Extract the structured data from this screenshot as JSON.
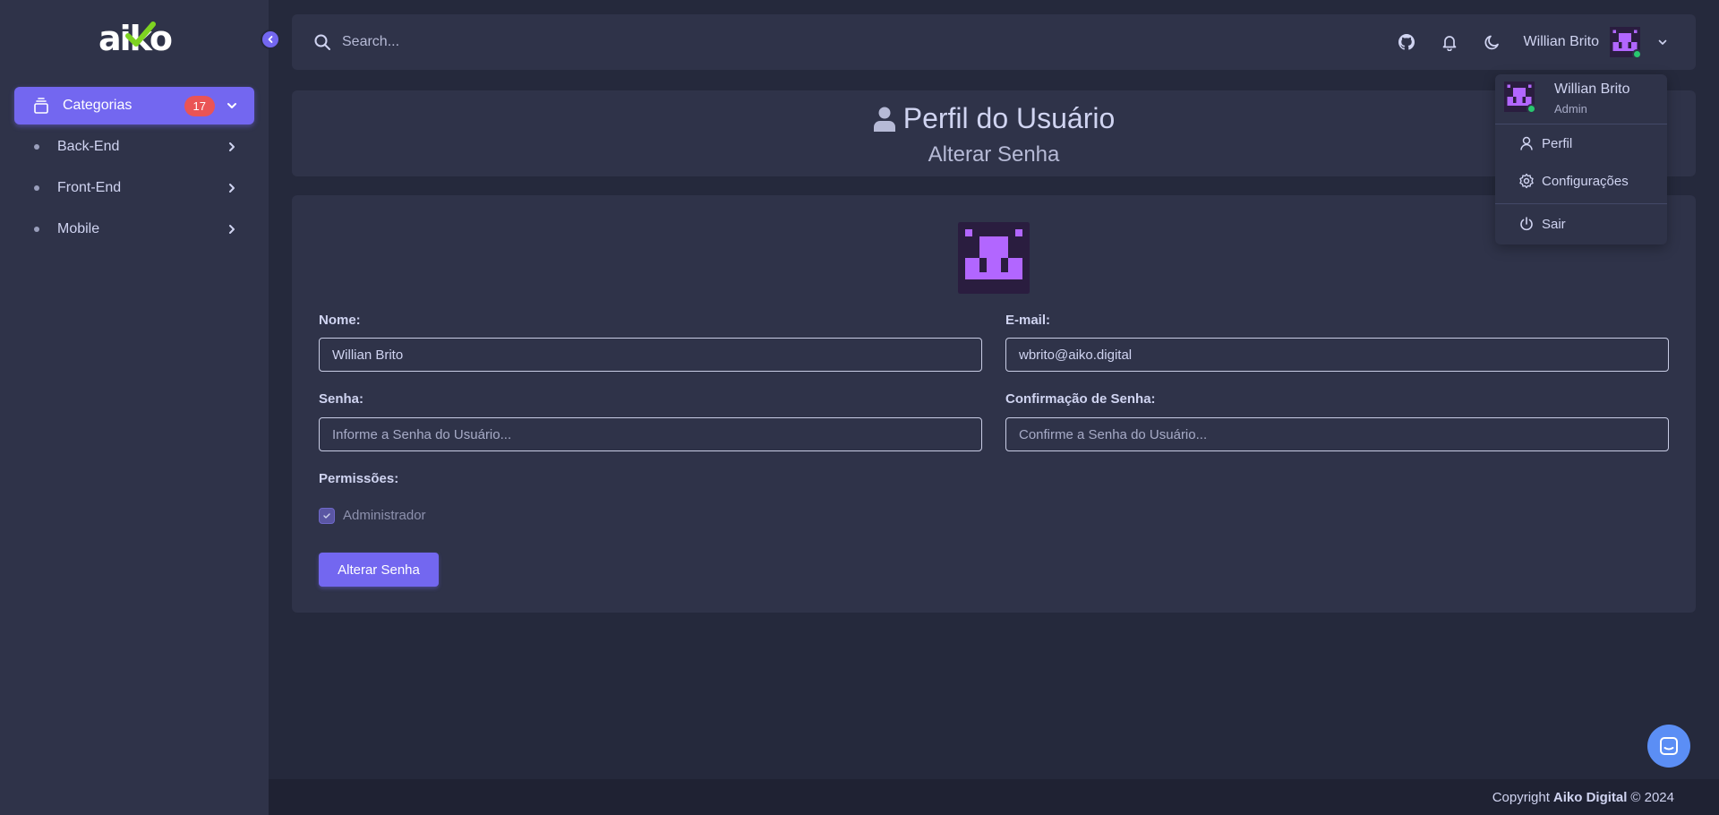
{
  "sidebar": {
    "logo": "aiko",
    "active_item": {
      "label": "Categorias",
      "badge": "17"
    },
    "items": [
      {
        "label": "Back-End"
      },
      {
        "label": "Front-End"
      },
      {
        "label": "Mobile"
      }
    ]
  },
  "header": {
    "search_placeholder": "Search...",
    "user_name": "Willian Brito",
    "icons": [
      "github-icon",
      "bell-icon",
      "moon-icon",
      "chevron-down-icon"
    ]
  },
  "dropdown": {
    "user_name": "Willian Brito",
    "role": "Admin",
    "items": [
      {
        "label": "Perfil"
      },
      {
        "label": "Configurações"
      },
      {
        "label": "Sair"
      }
    ]
  },
  "page": {
    "title": "Perfil do Usuário",
    "subtitle": "Alterar Senha"
  },
  "form": {
    "name_label": "Nome:",
    "name_value": "Willian Brito",
    "email_label": "E-mail:",
    "email_value": "wbrito@aiko.digital",
    "password_label": "Senha:",
    "password_placeholder": "Informe a Senha do Usuário...",
    "confirm_label": "Confirmação de Senha:",
    "confirm_placeholder": "Confirme a Senha do Usuário...",
    "permissions_label": "Permissões:",
    "admin_label": "Administrador",
    "admin_checked": true,
    "submit_label": "Alterar Senha"
  },
  "footer": {
    "prefix": "Copyright",
    "company": "Aiko Digital",
    "suffix": "© 2024"
  },
  "colors": {
    "primary": "#7367f0",
    "background": "#25293c",
    "card": "#2f3349",
    "badge": "#ea5455",
    "online": "#28c76f",
    "avatar_purple": "#b266ff"
  }
}
